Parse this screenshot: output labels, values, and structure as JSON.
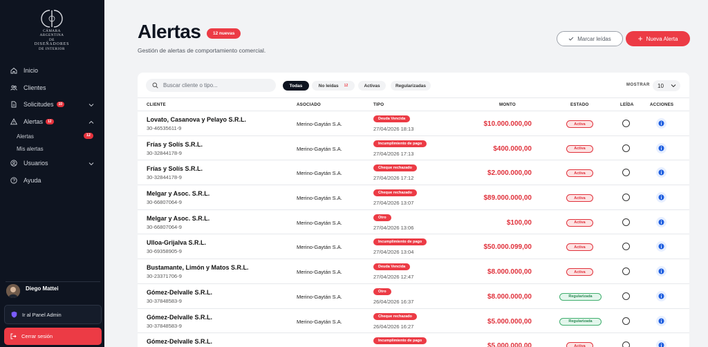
{
  "sidebar": {
    "logo": {
      "line1": "CÁMARA ARGENTINA",
      "line2": "DE",
      "line3": "DISEÑADORES",
      "line4": "DE INTERIOR"
    },
    "nav": {
      "inicio": "Inicio",
      "clientes": "Clientes",
      "solicitudes": {
        "label": "Solicitudes",
        "badge": "10"
      },
      "alertas": {
        "label": "Alertas",
        "badge": "12"
      },
      "alertas_sub": {
        "label": "Alertas",
        "badge": "12"
      },
      "mis_alertas": "Mis alertas",
      "usuarios": "Usuarios",
      "ayuda": "Ayuda"
    },
    "user_name": "Diego Mattei",
    "admin_button": "Ir al Panel Admin",
    "logout_button": "Cerrar sesión"
  },
  "header": {
    "title": "Alertas",
    "badge": "12 nuevas",
    "subtitle": "Gestión de alertas de comportamiento comercial.",
    "mark_read_button": "Marcar leídas",
    "new_alert_button": "Nueva Alerta"
  },
  "toolbar": {
    "search_placeholder": "Buscar cliente o tipo...",
    "filters": {
      "todas": "Todas",
      "no_leidas": {
        "label": "No leídas",
        "count": "12"
      },
      "activas": "Activas",
      "regularizadas": "Regularizadas"
    },
    "mostrar_label": "MOSTRAR",
    "mostrar_value": "10"
  },
  "table": {
    "headers": {
      "cliente": "CLIENTE",
      "asociado": "ASOCIADO",
      "tipo": "TIPO",
      "monto": "MONTO",
      "estado": "ESTADO",
      "leida": "LEÍDA",
      "acciones": "ACCIONES"
    },
    "rows": [
      {
        "cliente": "Lovato, Casanova y Pelayo S.R.L.",
        "cuit": "30-46535611-9",
        "asociado": "Merino-Gaytán S.A.",
        "tipo": "Deuda Vencida",
        "fecha": "27/04/2026 18:13",
        "monto": "$10.000.000,00",
        "estado": "Activa"
      },
      {
        "cliente": "Frías y Solís S.R.L.",
        "cuit": "30-32844178-9",
        "asociado": "Merino-Gaytán S.A.",
        "tipo": "Incumplimiento de pago",
        "fecha": "27/04/2026 17:13",
        "monto": "$400.000,00",
        "estado": "Activa"
      },
      {
        "cliente": "Frías y Solís S.R.L.",
        "cuit": "30-32844178-9",
        "asociado": "Merino-Gaytán S.A.",
        "tipo": "Cheque rechazado",
        "fecha": "27/04/2026 17:12",
        "monto": "$2.000.000,00",
        "estado": "Activa"
      },
      {
        "cliente": "Melgar y Asoc. S.R.L.",
        "cuit": "30-66807064-9",
        "asociado": "Merino-Gaytán S.A.",
        "tipo": "Cheque rechazado",
        "fecha": "27/04/2026 13:07",
        "monto": "$89.000.000,00",
        "estado": "Activa"
      },
      {
        "cliente": "Melgar y Asoc. S.R.L.",
        "cuit": "30-66807064-9",
        "asociado": "Merino-Gaytán S.A.",
        "tipo": "Otro",
        "fecha": "27/04/2026 13:06",
        "monto": "$100,00",
        "estado": "Activa"
      },
      {
        "cliente": "Ulloa-Grijalva S.R.L.",
        "cuit": "30-69358905-9",
        "asociado": "Merino-Gaytán S.A.",
        "tipo": "Incumplimiento de pago",
        "fecha": "27/04/2026 13:04",
        "monto": "$50.000.099,00",
        "estado": "Activa"
      },
      {
        "cliente": "Bustamante, Limón y Matos S.R.L.",
        "cuit": "30-23371706-9",
        "asociado": "Merino-Gaytán S.A.",
        "tipo": "Deuda Vencida",
        "fecha": "27/04/2026 12:47",
        "monto": "$8.000.000,00",
        "estado": "Activa"
      },
      {
        "cliente": "Gómez-Delvalle S.R.L.",
        "cuit": "30-37848583-9",
        "asociado": "Merino-Gaytán S.A.",
        "tipo": "Otro",
        "fecha": "26/04/2026 16:37",
        "monto": "$8.000.000,00",
        "estado": "Regularizada"
      },
      {
        "cliente": "Gómez-Delvalle S.R.L.",
        "cuit": "30-37848583-9",
        "asociado": "Merino-Gaytán S.A.",
        "tipo": "Cheque rechazado",
        "fecha": "26/04/2026 16:27",
        "monto": "$5.000.000,00",
        "estado": "Regularizada"
      },
      {
        "cliente": "Gómez-Delvalle S.R.L.",
        "cuit": "",
        "asociado": "",
        "tipo": "Incumplimiento de pago",
        "fecha": "",
        "monto": "$5.000.000,00",
        "estado": "Activa"
      }
    ]
  },
  "colors": {
    "accent": "#ec3b45",
    "sidebar_bg": "#0e1420",
    "success": "#3fae6d"
  }
}
